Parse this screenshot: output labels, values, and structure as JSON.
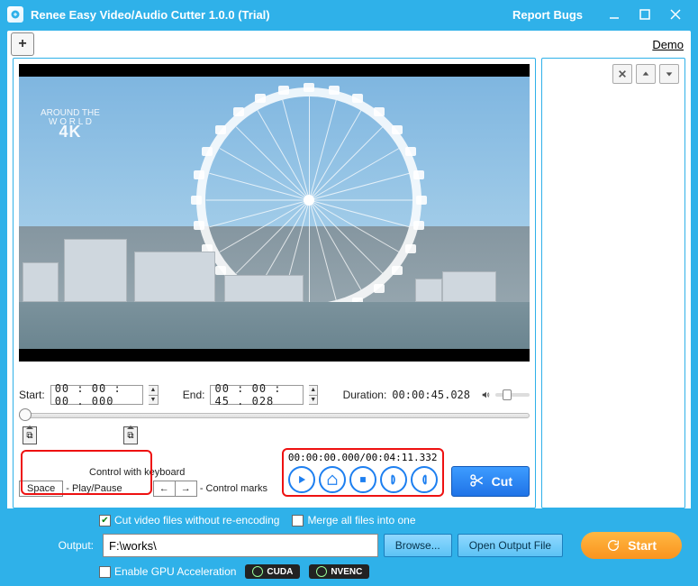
{
  "titlebar": {
    "title": "Renee Easy Video/Audio Cutter 1.0.0 (Trial)",
    "report_bugs": "Report Bugs"
  },
  "toprow": {
    "demo": "Demo"
  },
  "video": {
    "logo_top": "AROUND THE",
    "logo_mid": "W O R L D",
    "logo_bottom": "4K"
  },
  "timerow": {
    "start_label": "Start:",
    "start_value": "00 : 00 : 00 . 000",
    "end_label": "End:",
    "end_value": "00 : 00 : 45 . 028",
    "duration_label": "Duration:",
    "duration_value": "00:00:45.028"
  },
  "kbd": {
    "caption": "Control with keyboard",
    "space": "Space",
    "space_desc": "- Play/Pause",
    "arrow_left": "←",
    "arrow_right": "→",
    "arrows_desc": "- Control marks"
  },
  "playback": {
    "time": "00:00:00.000/00:04:11.332"
  },
  "cut": {
    "label": "Cut"
  },
  "options": {
    "reencode": "Cut video files without re-encoding",
    "merge": "Merge all files into one"
  },
  "output": {
    "label": "Output:",
    "path": "F:\\works\\",
    "browse": "Browse...",
    "open": "Open Output File"
  },
  "gpu": {
    "enable": "Enable GPU Acceleration",
    "cuda": "CUDA",
    "nvenc": "NVENC"
  },
  "start": {
    "label": "Start"
  }
}
